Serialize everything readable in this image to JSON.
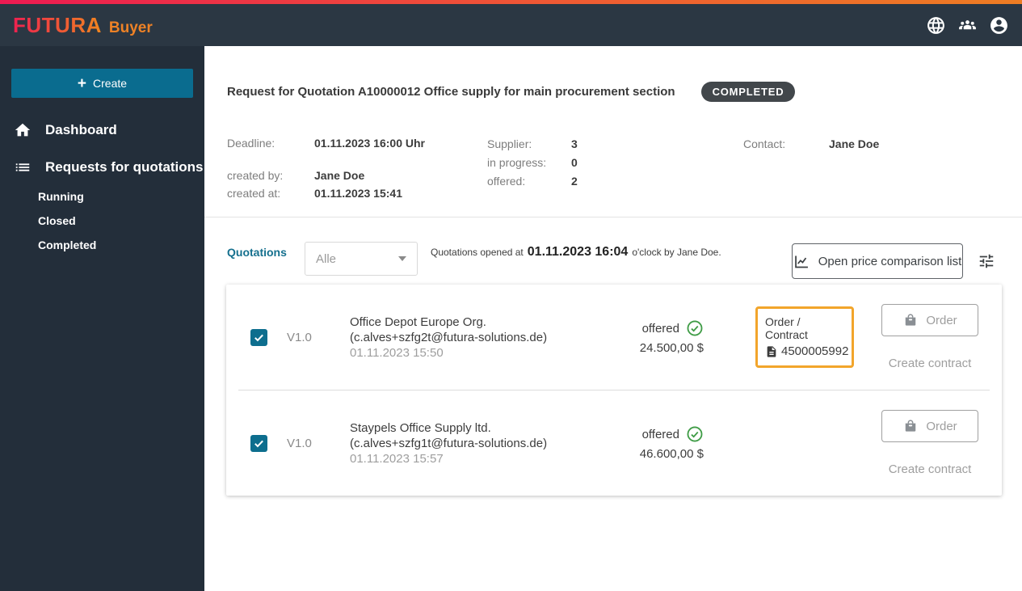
{
  "header": {
    "brand": "FUTURA",
    "brand_suffix": "Buyer",
    "icons": [
      "globe-icon",
      "users-icon",
      "account-icon"
    ]
  },
  "icons": {
    "plus": "+"
  },
  "colors": {
    "accent_teal": "#0d6e8e",
    "brand_gradient_start": "#ee2150",
    "brand_gradient_end": "#f0861f",
    "appbar_bg": "#2b3743",
    "sidebar_bg": "#232e3a",
    "status_badge_bg": "#42474b",
    "highlight_orange": "#f2a52b",
    "success_green": "#3f9c46"
  },
  "sidebar": {
    "create_label": "Create",
    "items": [
      {
        "label": "Dashboard"
      },
      {
        "label": "Requests for quotations",
        "children": [
          "Running",
          "Closed",
          "Completed"
        ]
      }
    ]
  },
  "rfq": {
    "title": "Request for Quotation A10000012 Office supply for main procurement section",
    "status": "COMPLETED",
    "details": {
      "deadline_label": "Deadline:",
      "deadline": "01.11.2023 16:00 Uhr",
      "created_by_label": "created by:",
      "created_by": "Jane Doe",
      "created_at_label": "created at:",
      "created_at": "01.11.2023 15:41",
      "supplier_label": "Supplier:",
      "supplier_count": "3",
      "in_progress_label": "in progress:",
      "in_progress_count": "0",
      "offered_label": "offered:",
      "offered_count": "2",
      "contact_label": "Contact:",
      "contact": "Jane Doe"
    }
  },
  "quotations": {
    "section_label": "Quotations",
    "filter_value": "Alle",
    "opened_prefix": "Quotations opened at",
    "opened_time": "01.11.2023 16:04",
    "opened_suffix": "o'clock by Jane Doe.",
    "compare_button_label": "Open price comparison list",
    "rows": [
      {
        "version": "V1.0",
        "supplier": "Office Depot Europe Org.",
        "email": "(c.alves+szfg2t@futura-solutions.de)",
        "date": "01.11.2023 15:50",
        "status": "offered",
        "price": "24.500,00 $",
        "order_contract_label": "Order / Contract",
        "order_number": "4500005992",
        "order_button_label": "Order",
        "create_contract_label": "Create contract"
      },
      {
        "version": "V1.0",
        "supplier": "Staypels Office Supply ltd.",
        "email": "(c.alves+szfg1t@futura-solutions.de)",
        "date": "01.11.2023 15:57",
        "status": "offered",
        "price": "46.600,00 $",
        "order_button_label": "Order",
        "create_contract_label": "Create contract"
      }
    ]
  }
}
